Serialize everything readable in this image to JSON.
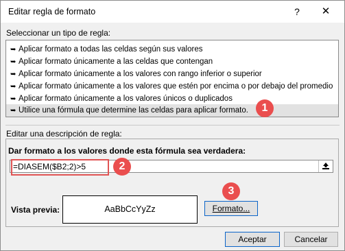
{
  "window": {
    "title": "Editar regla de formato",
    "help": "?",
    "close": "✕"
  },
  "rule_type": {
    "heading": "Seleccionar un tipo de regla:",
    "items": [
      "Aplicar formato a todas las celdas según sus valores",
      "Aplicar formato únicamente a las celdas que contengan",
      "Aplicar formato únicamente a los valores con rango inferior o superior",
      "Aplicar formato únicamente a los valores que estén por encima o por debajo del promedio",
      "Aplicar formato únicamente a los valores únicos o duplicados",
      "Utilice una fórmula que determine las celdas para aplicar formato."
    ],
    "selected_index": 5,
    "item_arrow": "➥"
  },
  "description": {
    "heading": "Editar una descripción de regla:",
    "formula_label": "Dar formato a los valores donde esta fórmula sea verdadera:",
    "formula_value": "=DIASEM($B2;2)>5",
    "preview_label": "Vista previa:",
    "preview_sample": "AaBbCcYyZz",
    "format_button": "Formato..."
  },
  "buttons": {
    "ok": "Aceptar",
    "cancel": "Cancelar"
  },
  "annotations": {
    "badge_1": "1",
    "badge_2": "2",
    "badge_3": "3",
    "color": "#ea4e4e"
  }
}
